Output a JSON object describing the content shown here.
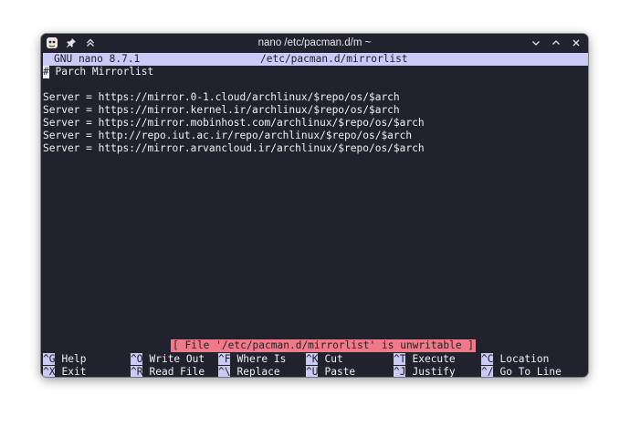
{
  "window": {
    "title": "nano /etc/pacman.d/m ~"
  },
  "editor": {
    "version": "GNU nano 8.7.1",
    "filename": "/etc/pacman.d/mirrorlist",
    "cursor_char": "#",
    "lines": [
      "# Parch Mirrorlist",
      "",
      "Server = https://mirror.0-1.cloud/archlinux/$repo/os/$arch",
      "Server = https://mirror.kernel.ir/archlinux/$repo/os/$arch",
      "Server = https://mirror.mobinhost.com/archlinux/$repo/os/$arch",
      "Server = http://repo.iut.ac.ir/repo/archlinux/$repo/os/$arch",
      "Server = https://mirror.arvancloud.ir/archlinux/$repo/os/$arch"
    ],
    "status_message": "[ File '/etc/pacman.d/mirrorlist' is unwritable ]"
  },
  "shortcuts": [
    {
      "key": "^G",
      "label": "Help"
    },
    {
      "key": "^O",
      "label": "Write Out"
    },
    {
      "key": "^F",
      "label": "Where Is"
    },
    {
      "key": "^K",
      "label": "Cut"
    },
    {
      "key": "^T",
      "label": "Execute"
    },
    {
      "key": "^C",
      "label": "Location"
    },
    {
      "key": "^X",
      "label": "Exit"
    },
    {
      "key": "^R",
      "label": "Read File"
    },
    {
      "key": "^\\",
      "label": "Replace"
    },
    {
      "key": "^U",
      "label": "Paste"
    },
    {
      "key": "^J",
      "label": "Justify"
    },
    {
      "key": "^/",
      "label": "Go To Line"
    }
  ],
  "icons": {
    "app": "terminal-app-icon",
    "pin": "pin-icon",
    "keep_above": "keep-above-icon",
    "minimize": "minimize-icon",
    "maximize": "maximize-icon",
    "close": "close-icon"
  },
  "colors": {
    "terminal_bg": "#22222e",
    "header_bar": "#c9cbf6",
    "status_bar": "#ef7a8a",
    "text": "#f0f0f4"
  }
}
